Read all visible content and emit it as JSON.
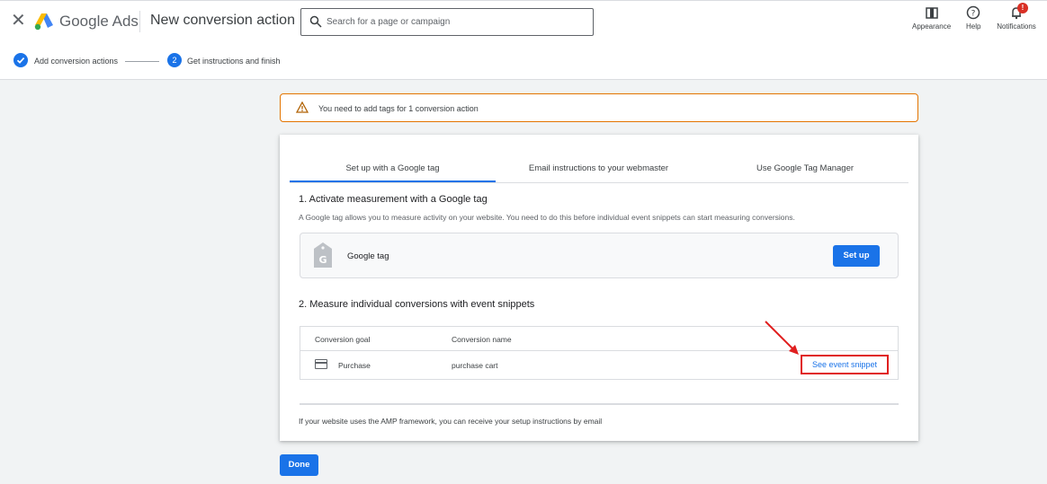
{
  "header": {
    "close_icon": "close-icon",
    "brand": "Google Ads",
    "title": "New conversion action",
    "search_placeholder": "Search for a page or campaign",
    "appearance_label": "Appearance",
    "help_label": "Help",
    "notifications_label": "Notifications",
    "notifications_badge": "!"
  },
  "stepper": {
    "step1_label": "Add conversion actions",
    "step2_number": "2",
    "step2_label": "Get instructions and finish"
  },
  "alert": {
    "text": "You need to add tags for 1 conversion action"
  },
  "tabs": [
    {
      "label": "Set up with a Google tag",
      "active": true
    },
    {
      "label": "Email instructions to your webmaster",
      "active": false
    },
    {
      "label": "Use Google Tag Manager",
      "active": false
    }
  ],
  "section1": {
    "title": "1. Activate measurement with a Google tag",
    "description": "A Google tag allows you to measure activity on your website. You need to do this before individual event snippets can start measuring conversions.",
    "tag_label": "Google tag",
    "setup_button": "Set up"
  },
  "section2": {
    "title": "2. Measure individual conversions with event snippets",
    "columns": [
      "Conversion goal",
      "Conversion name"
    ],
    "rows": [
      {
        "goal": "Purchase",
        "name": "purchase cart",
        "action": "See event snippet"
      }
    ]
  },
  "amp_note": "If your website uses the AMP framework, you can receive your setup instructions by email",
  "done_button": "Done",
  "colors": {
    "accent": "#1a73e8",
    "warning": "#e37400",
    "highlight": "#e01f1f"
  }
}
